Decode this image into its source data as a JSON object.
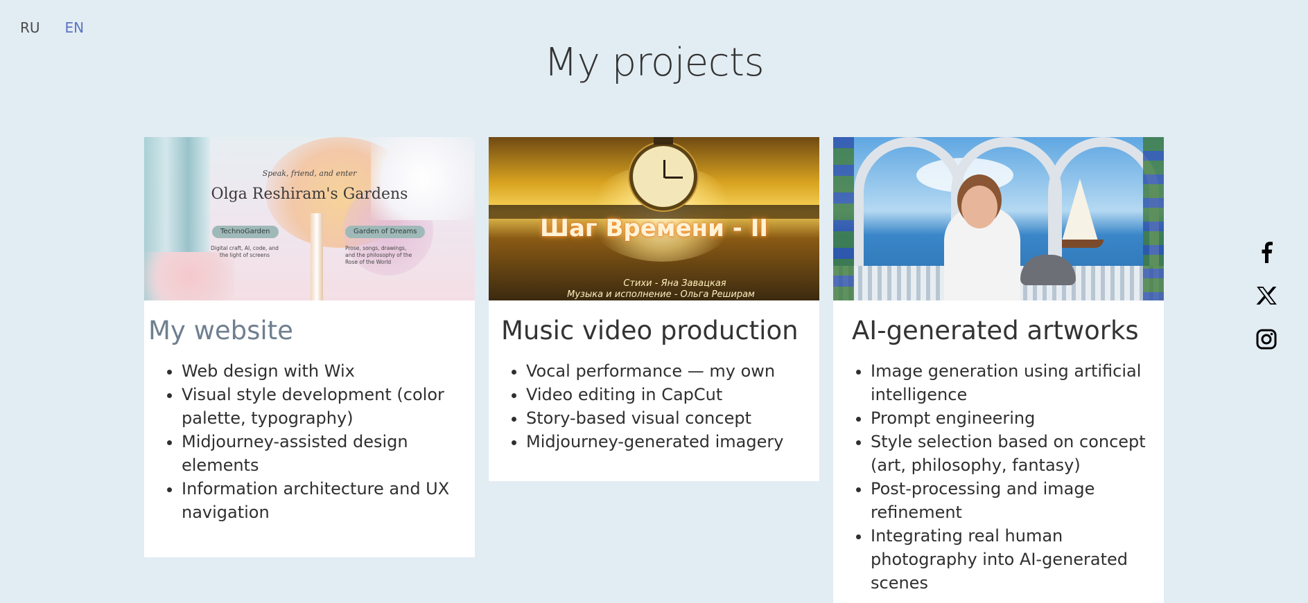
{
  "lang": {
    "ru": "RU",
    "en": "EN"
  },
  "page_title": "My projects",
  "cards": [
    {
      "title": "My website",
      "image": {
        "tagline": "Speak, friend, and enter",
        "site_name": "Olga Reshiram's Gardens",
        "pill_1": "TechnoGarden",
        "pill_2": "Garden of Dreams",
        "sub_1": "Digital craft, AI, code, and the light of screens",
        "sub_2": "Prose, songs, drawings, and the philosophy of the Rose of the World"
      },
      "items": [
        "Web design with Wix",
        "Visual style development (color palette, typography)",
        "Midjourney-assisted design elements",
        "Information architecture and UX navigation"
      ]
    },
    {
      "title": "Music video production",
      "image": {
        "title": "Шаг Времени - II",
        "credit_1": "Стихи - Яна Завацкая",
        "credit_2": "Музыка и исполнение - Ольга Реширам"
      },
      "items": [
        "Vocal performance — my own",
        "Video editing in CapCut",
        "Story-based visual concept",
        "Midjourney-generated imagery"
      ]
    },
    {
      "title": "AI-generated artworks",
      "items": [
        "Image generation using artificial intelligence",
        "Prompt engineering",
        "Style selection based on concept (art, philosophy, fantasy)",
        "Post-processing and image refinement",
        "Integrating real human photography into AI-generated scenes"
      ]
    }
  ],
  "social": [
    "facebook-icon",
    "x-icon",
    "instagram-icon"
  ]
}
